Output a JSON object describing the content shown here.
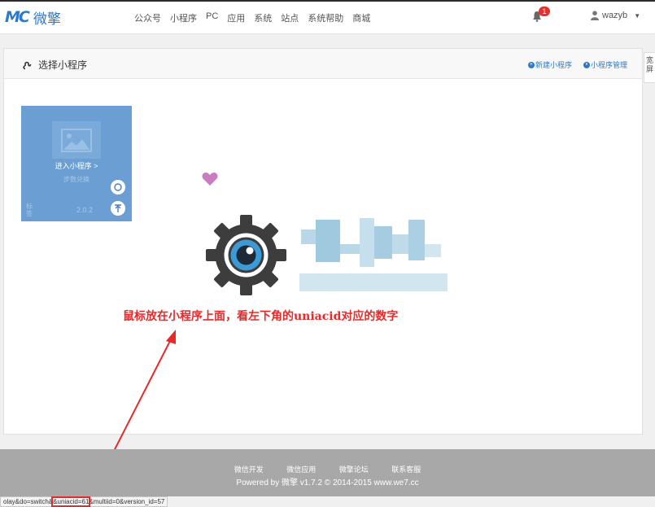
{
  "header": {
    "logo_mark": "MC",
    "logo_text": "微擎",
    "nav": [
      "公众号",
      "小程序",
      "PC",
      "应用",
      "系统",
      "站点",
      "系统帮助",
      "商城"
    ],
    "notification_count": "1",
    "username": "wazyb"
  },
  "panel": {
    "title": "选择小程序",
    "new_label": "新建小程序",
    "manage_label": "小程序管理"
  },
  "side_tab": "宽屏",
  "card": {
    "enter_label": "进入小程序 >",
    "sub_label": "步数兑换",
    "label": "标签",
    "version": "2.0.2"
  },
  "annotation": "鼠标放在小程序上面，看左下角的uniacid对应的数字",
  "footer": {
    "links": [
      "微信开发",
      "微信应用",
      "微擎论坛",
      "联系客服"
    ],
    "copyright": "Powered by 微擎 v1.7.2 © 2014-2015 www.we7.cc"
  },
  "status": {
    "prefix": "olay&do=switch&",
    "highlight": "&uniacid=61",
    "suffix": "&multiid=0&version_id=57"
  },
  "colors": {
    "accent": "#2f79c9",
    "card": "#6b9fd4",
    "annotation": "#e62a2a",
    "footer": "#a8a8a8"
  }
}
